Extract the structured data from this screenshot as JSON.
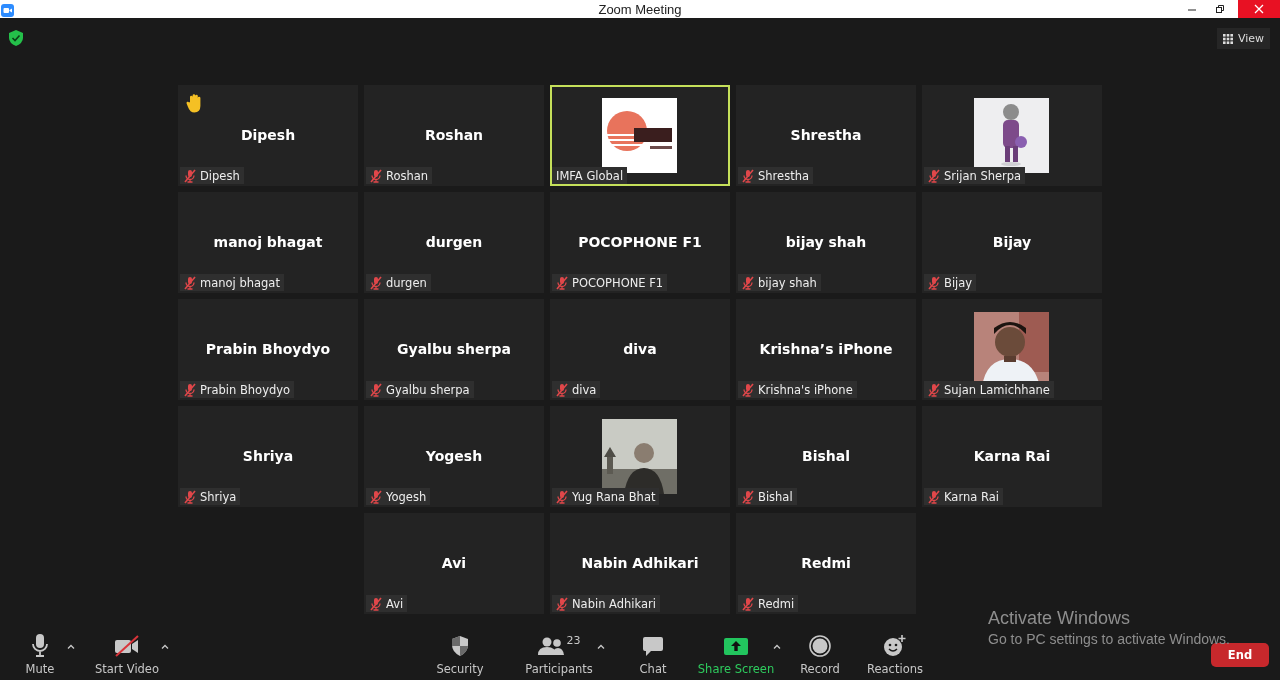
{
  "window": {
    "title": "Zoom Meeting"
  },
  "top_bar": {
    "view_button": "View"
  },
  "tiles": [
    {
      "kind": "name",
      "name": "Dipesh",
      "label": "Dipesh",
      "muted": true,
      "hand_raised": true,
      "active_speaker": false
    },
    {
      "kind": "name",
      "name": "Roshan",
      "label": "Roshan",
      "muted": true,
      "hand_raised": false,
      "active_speaker": false
    },
    {
      "kind": "picture",
      "label": "IMFA Global",
      "muted": false,
      "hand_raised": false,
      "active_speaker": true
    },
    {
      "kind": "name",
      "name": "Shrestha",
      "label": "Shrestha",
      "muted": true,
      "hand_raised": false,
      "active_speaker": false
    },
    {
      "kind": "picture",
      "label": "Srijan Sherpa",
      "muted": true,
      "hand_raised": false,
      "active_speaker": false
    },
    {
      "kind": "name",
      "name": "manoj bhagat",
      "label": "manoj bhagat",
      "muted": true,
      "hand_raised": false,
      "active_speaker": false
    },
    {
      "kind": "name",
      "name": "durgen",
      "label": "durgen",
      "muted": true,
      "hand_raised": false,
      "active_speaker": false
    },
    {
      "kind": "name",
      "name": "POCOPHONE F1",
      "label": "POCOPHONE F1",
      "muted": true,
      "hand_raised": false,
      "active_speaker": false
    },
    {
      "kind": "name",
      "name": "bijay shah",
      "label": "bijay shah",
      "muted": true,
      "hand_raised": false,
      "active_speaker": false
    },
    {
      "kind": "name",
      "name": "Bijay",
      "label": "Bijay",
      "muted": true,
      "hand_raised": false,
      "active_speaker": false
    },
    {
      "kind": "name",
      "name": "Prabin Bhoydyo",
      "label": "Prabin Bhoydyo",
      "muted": true,
      "hand_raised": false,
      "active_speaker": false
    },
    {
      "kind": "name",
      "name": "Gyalbu sherpa",
      "label": "Gyalbu sherpa",
      "muted": true,
      "hand_raised": false,
      "active_speaker": false
    },
    {
      "kind": "name",
      "name": "diva",
      "label": "diva",
      "muted": true,
      "hand_raised": false,
      "active_speaker": false
    },
    {
      "kind": "name",
      "name": "Krishna’s iPhone",
      "label": "Krishna's iPhone",
      "muted": true,
      "hand_raised": false,
      "active_speaker": false
    },
    {
      "kind": "picture",
      "label": "Sujan Lamichhane",
      "muted": true,
      "hand_raised": false,
      "active_speaker": false
    },
    {
      "kind": "name",
      "name": "Shriya",
      "label": "Shriya",
      "muted": true,
      "hand_raised": false,
      "active_speaker": false
    },
    {
      "kind": "name",
      "name": "Yogesh",
      "label": "Yogesh",
      "muted": true,
      "hand_raised": false,
      "active_speaker": false
    },
    {
      "kind": "picture",
      "label": "Yug Rana Bhat",
      "muted": true,
      "hand_raised": false,
      "active_speaker": false
    },
    {
      "kind": "name",
      "name": "Bishal",
      "label": "Bishal",
      "muted": true,
      "hand_raised": false,
      "active_speaker": false
    },
    {
      "kind": "name",
      "name": "Karna Rai",
      "label": "Karna Rai",
      "muted": true,
      "hand_raised": false,
      "active_speaker": false
    },
    {
      "kind": "name",
      "name": "Avi",
      "label": "Avi",
      "muted": true,
      "hand_raised": false,
      "active_speaker": false
    },
    {
      "kind": "name",
      "name": "Nabin Adhikari",
      "label": "Nabin Adhikari",
      "muted": true,
      "hand_raised": false,
      "active_speaker": false
    },
    {
      "kind": "name",
      "name": "Redmi",
      "label": "Redmi",
      "muted": true,
      "hand_raised": false,
      "active_speaker": false
    }
  ],
  "toolbar": {
    "items": [
      {
        "kind": "mute",
        "label": "Mute",
        "caret": true
      },
      {
        "kind": "video",
        "label": "Start Video",
        "caret": true
      },
      {
        "kind": "security",
        "label": "Security",
        "caret": false
      },
      {
        "kind": "participants",
        "label": "Participants",
        "count": "23",
        "caret": true
      },
      {
        "kind": "chat",
        "label": "Chat",
        "caret": false
      },
      {
        "kind": "share",
        "label": "Share Screen",
        "caret": true
      },
      {
        "kind": "record",
        "label": "Record",
        "caret": false
      },
      {
        "kind": "reactions",
        "label": "Reactions",
        "caret": false
      }
    ],
    "end_button": "End"
  },
  "activation_notice": {
    "title": "Activate Windows",
    "subtitle": "Go to PC settings to activate Windows."
  }
}
